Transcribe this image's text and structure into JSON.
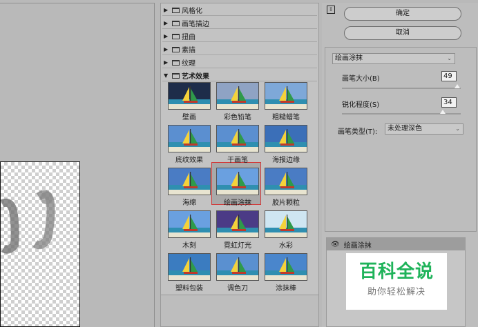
{
  "gallery": {
    "folders": [
      {
        "label": "风格化",
        "arrow": "▶"
      },
      {
        "label": "画笔描边",
        "arrow": "▶"
      },
      {
        "label": "扭曲",
        "arrow": "▶"
      },
      {
        "label": "素描",
        "arrow": "▶"
      },
      {
        "label": "纹理",
        "arrow": "▶"
      },
      {
        "label": "艺术效果",
        "arrow": "▼"
      }
    ],
    "filters": [
      {
        "label": "壁画"
      },
      {
        "label": "彩色铅笔"
      },
      {
        "label": "粗糙蜡笔"
      },
      {
        "label": "底纹效果"
      },
      {
        "label": "干画笔"
      },
      {
        "label": "海报边缘"
      },
      {
        "label": "海绵"
      },
      {
        "label": "绘画涂抹"
      },
      {
        "label": "胶片颗粒"
      },
      {
        "label": "木刻"
      },
      {
        "label": "霓虹灯光"
      },
      {
        "label": "水彩"
      },
      {
        "label": "塑料包装"
      },
      {
        "label": "调色刀"
      },
      {
        "label": "涂抹棒"
      }
    ],
    "selected_filter": "绘画涂抹"
  },
  "actions": {
    "collapse_glyph": "⇳",
    "ok_label": "确定",
    "cancel_label": "取消"
  },
  "settings": {
    "filter_select": "绘画涂抹",
    "brush_size_label": "画笔大小(B)",
    "brush_size_value": "49",
    "sharpness_label": "锐化程度(S)",
    "sharpness_value": "34",
    "brush_type_label": "画笔类型(T):",
    "brush_type_value": "未处理深色"
  },
  "layers": {
    "eye_glyph": "👁",
    "active_layer": "绘画涂抹"
  },
  "watermark": {
    "line1": "百科全说",
    "line2": "助你轻松解决"
  },
  "colors": {
    "selection_border": "#d23838",
    "watermark_green": "#1fb35a"
  }
}
